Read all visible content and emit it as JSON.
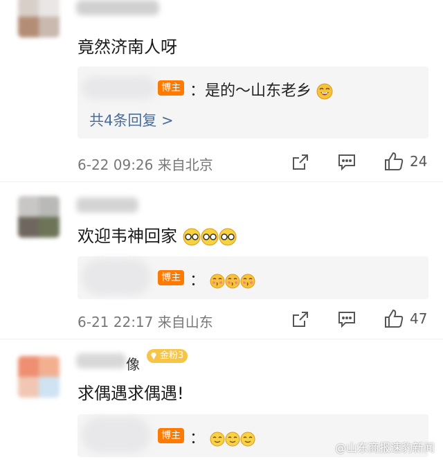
{
  "comments": [
    {
      "username": "",
      "text": "竟然济南人呀",
      "reply": {
        "badge": "博主",
        "text": "：是的～山东老乡",
        "more": "共4条回复 >"
      },
      "meta": "6-22 09:26 来自北京",
      "likes": "24"
    },
    {
      "username": "",
      "text": "欢迎韦神回家",
      "reply": {
        "badge": "博主",
        "text": "："
      },
      "meta": "6-21 22:17 来自山东",
      "likes": "47"
    },
    {
      "username": "像",
      "fan_badge": "金粉3",
      "text": "求偶遇求偶遇!",
      "reply": {
        "badge": "博主",
        "text": "："
      }
    }
  ],
  "watermark": "@山东商报速豹新闻",
  "colors": {
    "badge_orange": "#ff7a00",
    "link_blue": "#4a6d9b",
    "fan_gold": "#f7c44a"
  },
  "icons": [
    "share-icon",
    "comment-icon",
    "like-icon",
    "emoji-icon"
  ]
}
